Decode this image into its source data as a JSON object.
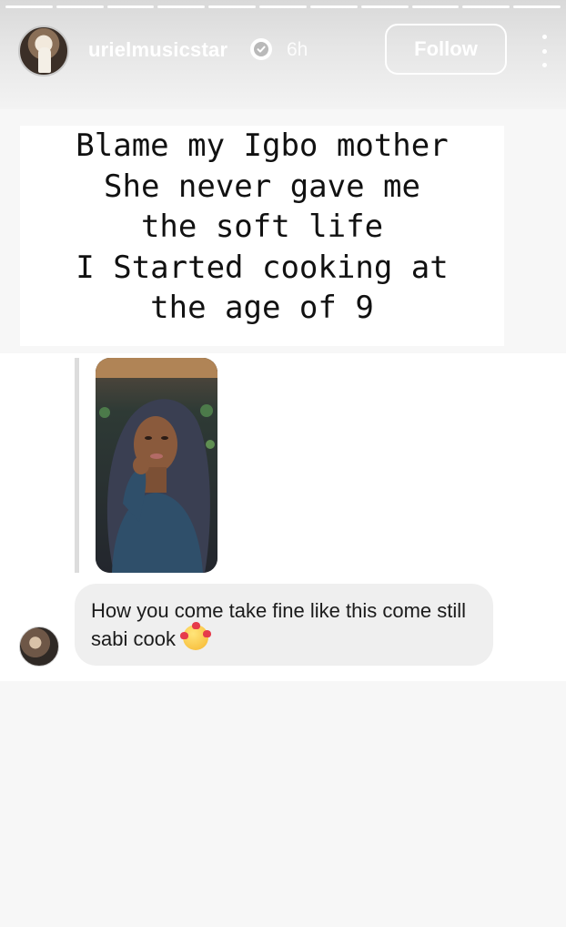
{
  "header": {
    "username": "urielmusicstar",
    "time_ago": "6h",
    "follow_label": "Follow"
  },
  "progress_segments": 11,
  "story_text": [
    "Blame my Igbo mother",
    "She never gave me",
    "the soft life",
    "I Started cooking at",
    "the age of 9"
  ],
  "reply": {
    "message": "How you come take fine like this come still sabi cook",
    "emoji": "smiling-face-with-hearts-icon"
  },
  "colors": {
    "header_text": "#ffffff",
    "bubble_bg": "#efefef"
  }
}
